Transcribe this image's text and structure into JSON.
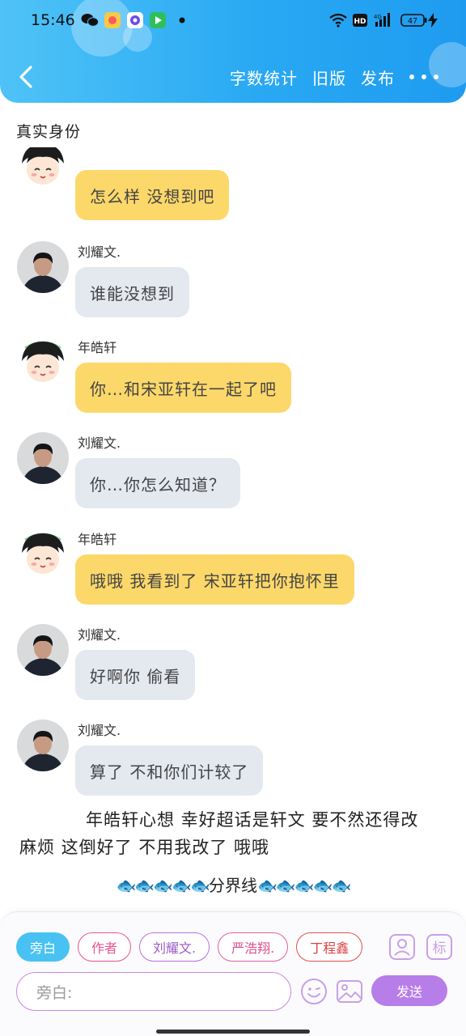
{
  "status_bar": {
    "time": "15:46",
    "battery": "47"
  },
  "header": {
    "actions": [
      {
        "label": "字数统计"
      },
      {
        "label": "旧版"
      },
      {
        "label": "发布"
      }
    ]
  },
  "section_label": "真实身份",
  "messages": [
    {
      "sender": "",
      "text": "怎么样 没想到吧",
      "style": "yellow",
      "avatar": "cartoon"
    },
    {
      "sender": "刘耀文.",
      "text": "谁能没想到",
      "style": "grey",
      "avatar": "photo"
    },
    {
      "sender": "年皓轩",
      "text": "你…和宋亚轩在一起了吧",
      "style": "yellow",
      "avatar": "cartoon"
    },
    {
      "sender": "刘耀文.",
      "text": "你…你怎么知道？",
      "style": "grey",
      "avatar": "photo"
    },
    {
      "sender": "年皓轩",
      "text": "哦哦 我看到了 宋亚轩把你抱怀里",
      "style": "yellow",
      "avatar": "cartoon"
    },
    {
      "sender": "刘耀文.",
      "text": "好啊你 偷看",
      "style": "grey",
      "avatar": "photo"
    },
    {
      "sender": "刘耀文.",
      "text": "算了 不和你们计较了",
      "style": "grey",
      "avatar": "photo"
    }
  ],
  "narration": "年皓轩心想 幸好超话是轩文 要不然还得改 麻烦 这倒好了 不用我改了 哦哦",
  "divider": {
    "fish": "🐟🐟🐟🐟🐟",
    "label": "分界线"
  },
  "input_panel": {
    "roles": [
      {
        "label": "旁白"
      },
      {
        "label": "作者"
      },
      {
        "label": "刘耀文."
      },
      {
        "label": "严浩翔."
      },
      {
        "label": "丁程鑫"
      }
    ],
    "input_placeholder": "旁白:",
    "send_label": "发送",
    "tag_label": "标"
  },
  "colors": {
    "header_gradient_start": "#4fc3f7",
    "header_gradient_end": "#1e9bf0",
    "yellow_bubble": "#fcd86a",
    "grey_bubble": "#e4e8ef",
    "send_button": "#b77de8",
    "selected_role": "#48c2f2"
  }
}
